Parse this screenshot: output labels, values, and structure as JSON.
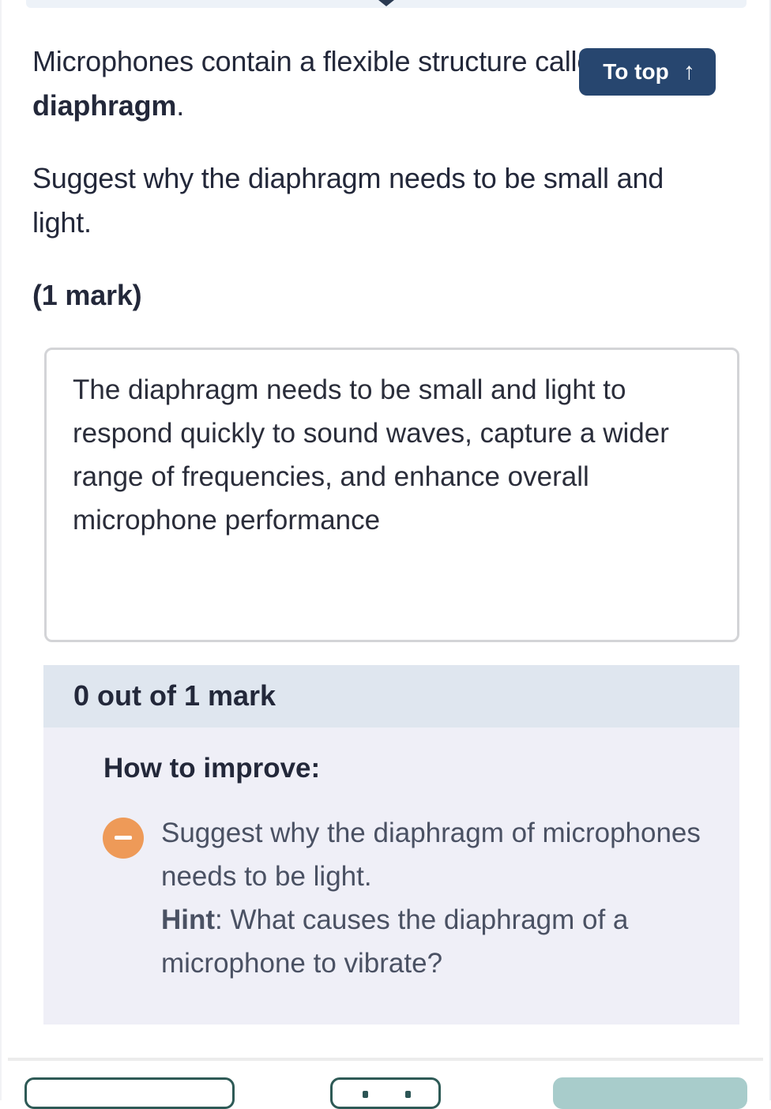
{
  "question": {
    "intro_text": "Microphones contain a flexible structure called a",
    "intro_term": "diaphragm",
    "intro_end": ".",
    "prompt": "Suggest why the diaphragm needs to be small and light.",
    "marks": "(1 mark)"
  },
  "to_top_button": {
    "label": "To top",
    "icon": "arrow-up-icon",
    "glyph": "↑",
    "background_color": "#27466f"
  },
  "answer": {
    "text": "The diaphragm needs to be small and light to respond quickly to sound waves, capture a wider range of frequencies, and enhance overall microphone performance"
  },
  "result": {
    "score_text": "0 out of 1 mark",
    "score": 0,
    "max_score": 1
  },
  "feedback": {
    "title": "How to improve:",
    "items": [
      {
        "icon": "minus-circle-icon",
        "icon_color": "#ee9a58",
        "text": "Suggest why the diaphragm of microphones needs to be light.",
        "hint_label": "Hint",
        "hint_text": ": What causes the diaphragm of a microphone to vibrate?"
      }
    ]
  },
  "colors": {
    "accent_dark": "#27466f",
    "result_header_bg": "#dfe6ef",
    "feedback_bg": "#efeff7",
    "button_outline": "#2e5a56",
    "button_disabled_fill": "#a8cccb"
  }
}
